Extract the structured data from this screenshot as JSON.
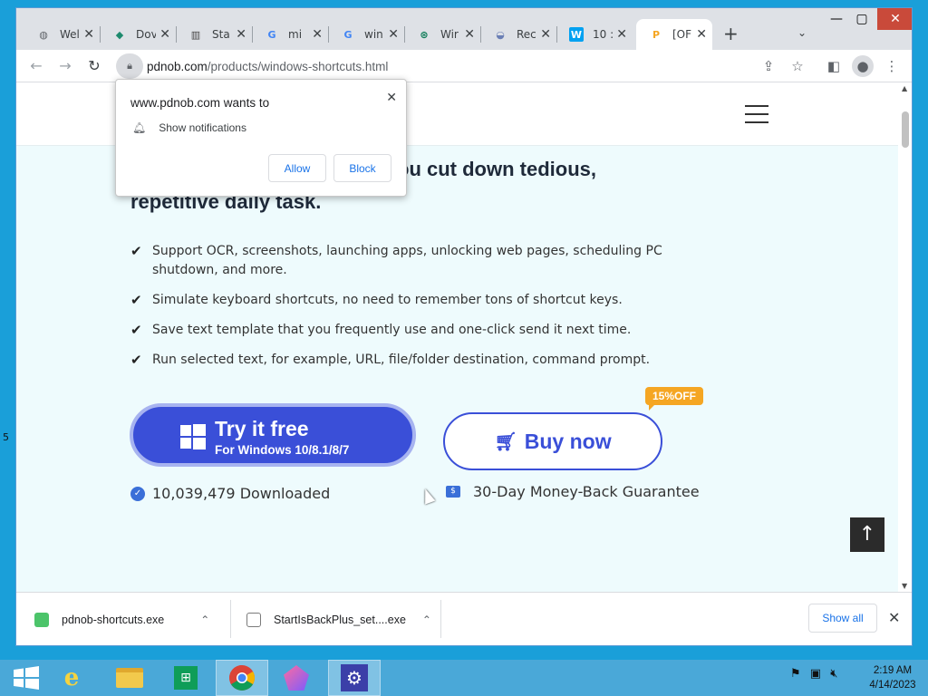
{
  "browser": {
    "tabs": [
      {
        "title": "Wel",
        "icon": "globe-icon",
        "fav_color": "#5f6368"
      },
      {
        "title": "Dov",
        "icon": "leaf-icon",
        "fav_color": "#1e8a6e"
      },
      {
        "title": "Sta",
        "icon": "book-icon",
        "fav_color": "#444"
      },
      {
        "title": "mi",
        "icon": "google-icon",
        "fav_color": "#4285f4"
      },
      {
        "title": "win",
        "icon": "google-icon",
        "fav_color": "#4285f4"
      },
      {
        "title": "Wir",
        "icon": "windows-logo-icon",
        "fav_color": "#0b7a55"
      },
      {
        "title": "Rec",
        "icon": "rec-icon",
        "fav_color": "#6b7fb5"
      },
      {
        "title": "10 :",
        "icon": "w-icon",
        "fav_color": "#00a1f1"
      },
      {
        "title": "[OF",
        "icon": "pdnob-icon",
        "fav_color": "#f5a623",
        "active": true
      }
    ],
    "url_host": "pdnob.com",
    "url_path": "/products/windows-shortcuts.html"
  },
  "notification": {
    "title": "www.pdnob.com wants to",
    "permission": "Show notifications",
    "allow_label": "Allow",
    "block_label": "Block"
  },
  "page": {
    "headline_line1": "ou cut down tedious,",
    "headline_line2": "repetitive daily task.",
    "features": [
      "Support OCR, screenshots, launching apps, unlocking web pages, scheduling PC shutdown, and more.",
      "Simulate keyboard shortcuts, no need to remember tons of shortcut keys.",
      "Save text template that you frequently use and one-click send it next time.",
      "Run selected text, for example, URL, file/folder destination, command prompt."
    ],
    "try_title": "Try it free",
    "try_sub": "For Windows 10/8.1/8/7",
    "buy_label": "Buy now",
    "discount_badge": "15%OFF",
    "downloads_text": "10,039,479 Downloaded",
    "guarantee_text": "30-Day Money-Back Guarantee",
    "brand_color": "#3a4fd8",
    "badge_color": "#f5a623"
  },
  "downloads": [
    {
      "name": "pdnob-shortcuts.exe",
      "icon": "app-icon",
      "color": "#4cc46a"
    },
    {
      "name": "StartIsBackPlus_set....exe",
      "icon": "installer-icon",
      "color": "#7a7a7a"
    }
  ],
  "shelf": {
    "show_all_label": "Show all"
  },
  "taskbar": {
    "time": "2:19 AM",
    "date": "4/14/2023"
  },
  "edge_label": "5"
}
